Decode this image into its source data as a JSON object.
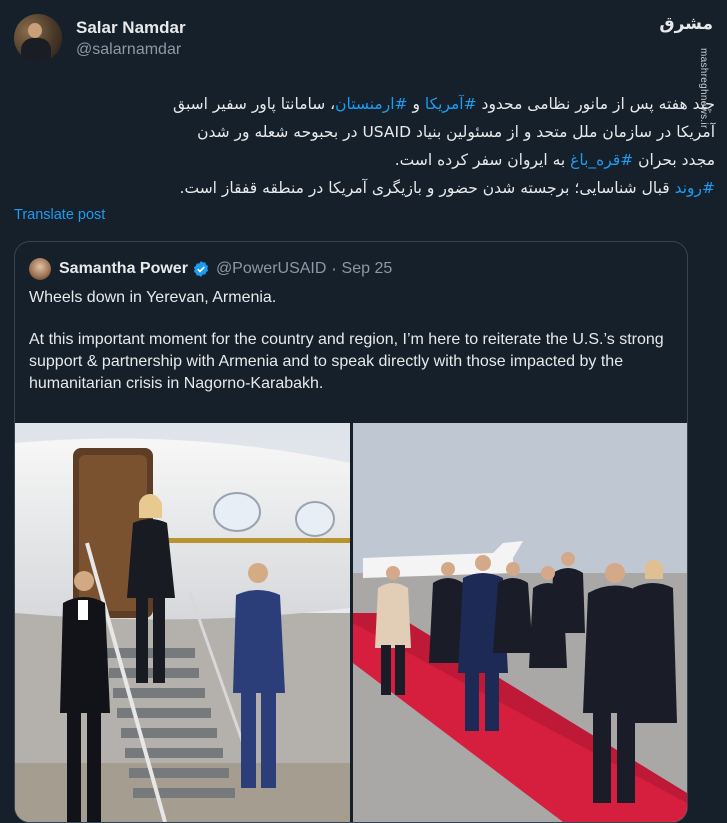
{
  "post": {
    "author_name": "Salar Namdar",
    "author_handle": "@salarnamdar",
    "text_lines": [
      "چند هفته پس از مانور نظامی محدود  #آمریکا و #ارمنستان، سامانتا پاور سفیر اسبق",
      "آمریکا در سازمان ملل متحد و از مسئولین بنیاد USAID در بحبوحه شعله ور شدن",
      "مجدد بحران #قره_باغ به ایروان سفر کرده است.",
      "#روند قبال شناسایی؛ برجسته شدن حضور و بازیگری آمریکا در منطقه قفقاز است."
    ],
    "translate_label": "Translate post"
  },
  "watermark": {
    "logo_text": "مشرق",
    "url": "mashreghnews.ir"
  },
  "quote": {
    "author_name": "Samantha Power",
    "author_handle": "@PowerUSAID",
    "separator": "·",
    "date": "Sep 25",
    "line1": "Wheels down in Yerevan, Armenia.",
    "line2": "At this important moment for the country and region, I’m here to reiterate the U.S.’s strong support & partnership with Armenia and to speak directly with those impacted by the humanitarian crisis in Nagorno-Karabakh."
  },
  "colors": {
    "background": "#15202b",
    "text": "#e7e9ea",
    "secondary": "#8b98a5",
    "link": "#1d9bf0",
    "border": "#38444d",
    "carpet": "#d61f3f"
  },
  "icons": {
    "verified": "verified-badge-icon"
  }
}
